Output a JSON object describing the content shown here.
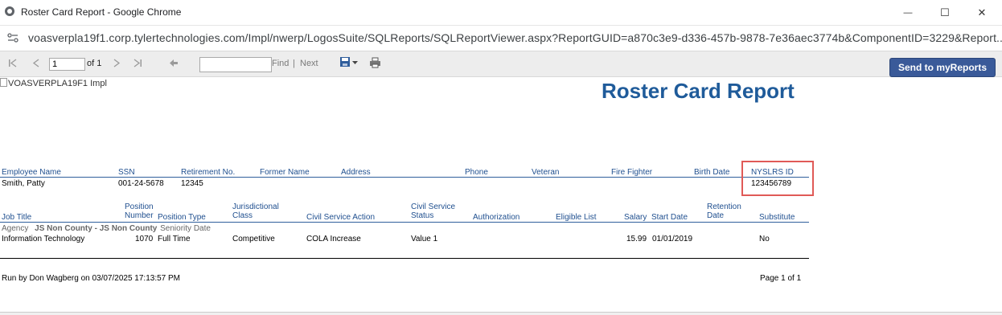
{
  "window": {
    "title": "Roster Card Report - Google Chrome",
    "minimize_glyph": "—",
    "maximize_glyph": "☐",
    "close_glyph": "✕"
  },
  "browser": {
    "url": "voasverpla19f1.corp.tylertechnologies.com/Impl/nwerp/LogosSuite/SQLReports/SQLReportViewer.aspx?ReportGUID=a870c3e9-d336-457b-9878-7e36aec3774b&ComponentID=3229&Report..."
  },
  "toolbar": {
    "page_value": "1",
    "page_of": "of 1",
    "find_label": "Find",
    "separator": "|",
    "next_label": "Next",
    "send_button": "Send to myReports"
  },
  "report": {
    "logo_alt": "VOASVERPLA19F1 Impl",
    "title": "Roster Card Report",
    "employee_headers": {
      "name": "Employee Name",
      "ssn": "SSN",
      "retirement": "Retirement No.",
      "former": "Former Name",
      "address": "Address",
      "phone": "Phone",
      "veteran": "Veteran",
      "firefighter": "Fire Fighter",
      "birth": "Birth Date",
      "nyslrs": "NYSLRS ID"
    },
    "employee": {
      "name": "Smith, Patty",
      "ssn": "001-24-5678",
      "retirement": "12345",
      "nyslrs": "123456789"
    },
    "job_headers": {
      "job_title": "Job Title",
      "position_number_1": "Position",
      "position_number_2": "Number",
      "position_type": "Position Type",
      "jurisdictional_1": "Jurisdictional",
      "jurisdictional_2": "Class",
      "cs_action": "Civil Service Action",
      "cs_status_1": "Civil Service",
      "cs_status_2": "Status",
      "authorization": "Authorization",
      "eligible_list": "Eligible List",
      "salary": "Salary",
      "start_date": "Start Date",
      "retention_1": "Retention",
      "retention_2": "Date",
      "substitute": "Substitute"
    },
    "agency_row": {
      "agency_label": "Agency",
      "agency_value": "JS Non County - JS Non County",
      "seniority_label": "Seniority Date"
    },
    "job": {
      "job_title": "Information Technology",
      "position_number": "1070",
      "position_type": "Full Time",
      "jurisdictional": "Competitive",
      "cs_action": "COLA Increase",
      "cs_status": "Value 1",
      "salary": "15.99",
      "start_date": "01/01/2019",
      "substitute": "No"
    },
    "footer": {
      "run_by": "Run by Don Wagberg on 03/07/2025 17:13:57 PM",
      "page": "Page 1 of 1"
    }
  }
}
